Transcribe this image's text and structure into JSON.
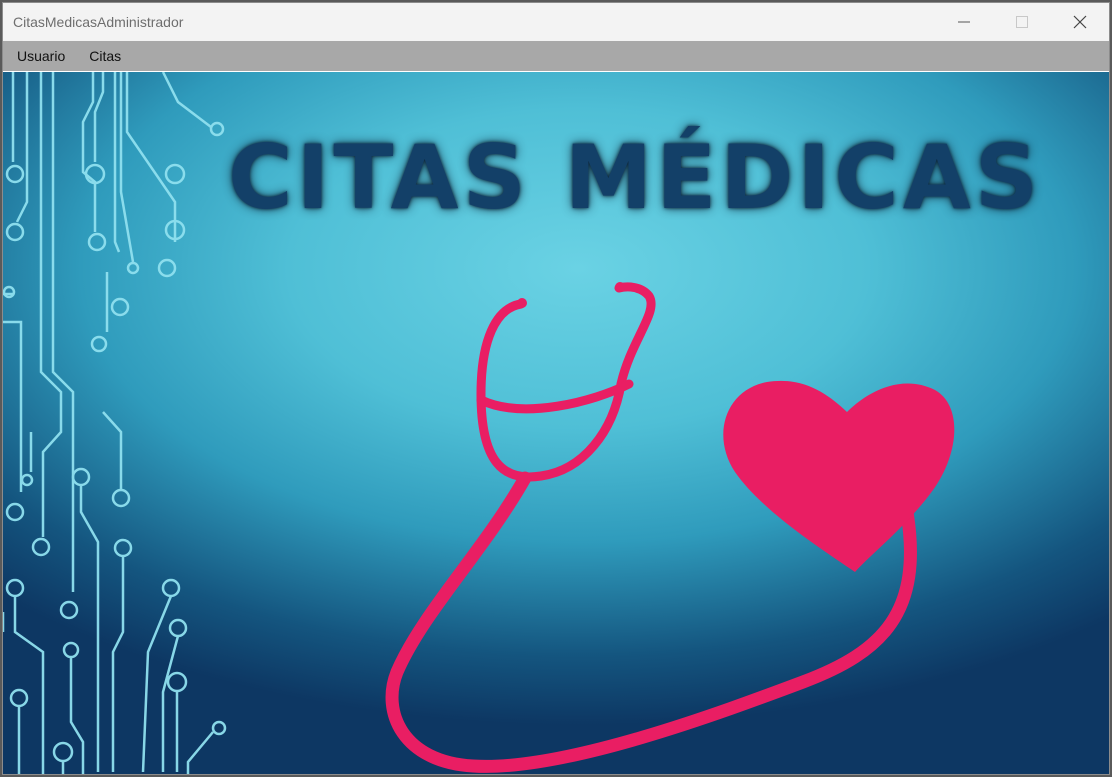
{
  "window": {
    "title": "CitasMedicasAdministrador",
    "controls": [
      "minimize-icon",
      "maximize-icon",
      "close-icon"
    ]
  },
  "menubar": {
    "items": [
      {
        "label": "Usuario"
      },
      {
        "label": "Citas"
      }
    ]
  },
  "content": {
    "hero_title": "CITAS MÉDICAS",
    "colors": {
      "title": "#134068",
      "accent": "#e91e63",
      "circuit": "#8fe0ef",
      "bg_light": "#6ad2e4",
      "bg_dark": "#0d3763"
    }
  }
}
